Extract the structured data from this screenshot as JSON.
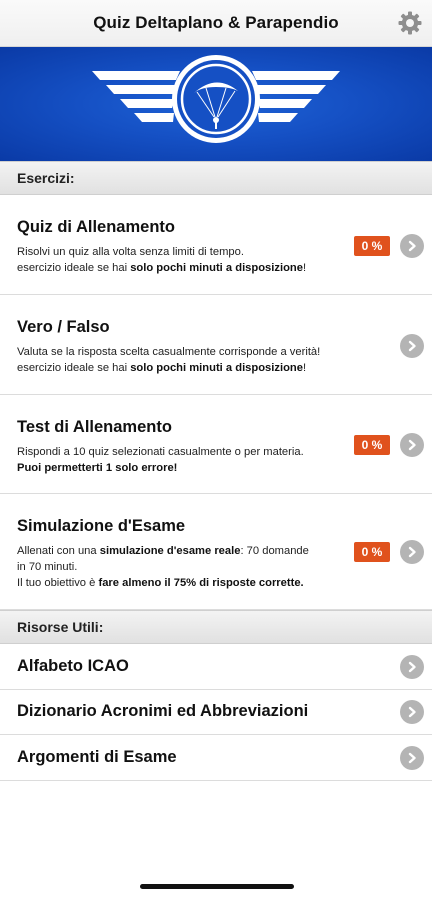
{
  "header": {
    "title": "Quiz Deltaplano & Parapendio",
    "settings_icon": "gear-icon"
  },
  "banner": {
    "logo_icon": "winged-paraglider-logo",
    "colors": {
      "background": "#1550c4",
      "wings": "#ffffff"
    }
  },
  "exercises": {
    "header": "Esercizi:",
    "items": [
      {
        "title": "Quiz di Allenamento",
        "desc_line1": "Risolvi un quiz alla volta senza limiti di tempo.",
        "desc_line2_prefix": "esercizio ideale se hai ",
        "desc_line2_bold": "solo pochi minuti a disposizione",
        "desc_line2_suffix": "!",
        "progress": "0 %"
      },
      {
        "title": "Vero / Falso",
        "desc_line1": "Valuta se la risposta scelta casualmente corrisponde a verità!",
        "desc_line2_prefix": "esercizio ideale se hai ",
        "desc_line2_bold": "solo pochi minuti a disposizione",
        "desc_line2_suffix": "!"
      },
      {
        "title": "Test di Allenamento",
        "desc_line1": "Rispondi a 10 quiz selezionati casualmente o per materia.",
        "desc_line2_bold": "Puoi permetterti 1 solo errore!",
        "progress": "0 %"
      },
      {
        "title": "Simulazione d'Esame",
        "desc_line1_prefix": "Allenati con una ",
        "desc_line1_bold": "simulazione d'esame reale",
        "desc_line1_suffix": ": 70 domande",
        "desc_line2": "in 70 minuti.",
        "desc_line3_prefix": "Il tuo obiettivo è ",
        "desc_line3_bold": "fare almeno il 75% di risposte corrette.",
        "progress": "0 %"
      }
    ]
  },
  "resources": {
    "header": "Risorse Utili:",
    "items": [
      {
        "title": "Alfabeto ICAO"
      },
      {
        "title": "Dizionario Acronimi ed Abbreviazioni"
      },
      {
        "title": "Argomenti di Esame"
      }
    ]
  },
  "colors": {
    "badge": "#e0521d",
    "chevron": "#b4b4b4"
  },
  "icons": {
    "row_arrow": "chevron-right-icon"
  }
}
